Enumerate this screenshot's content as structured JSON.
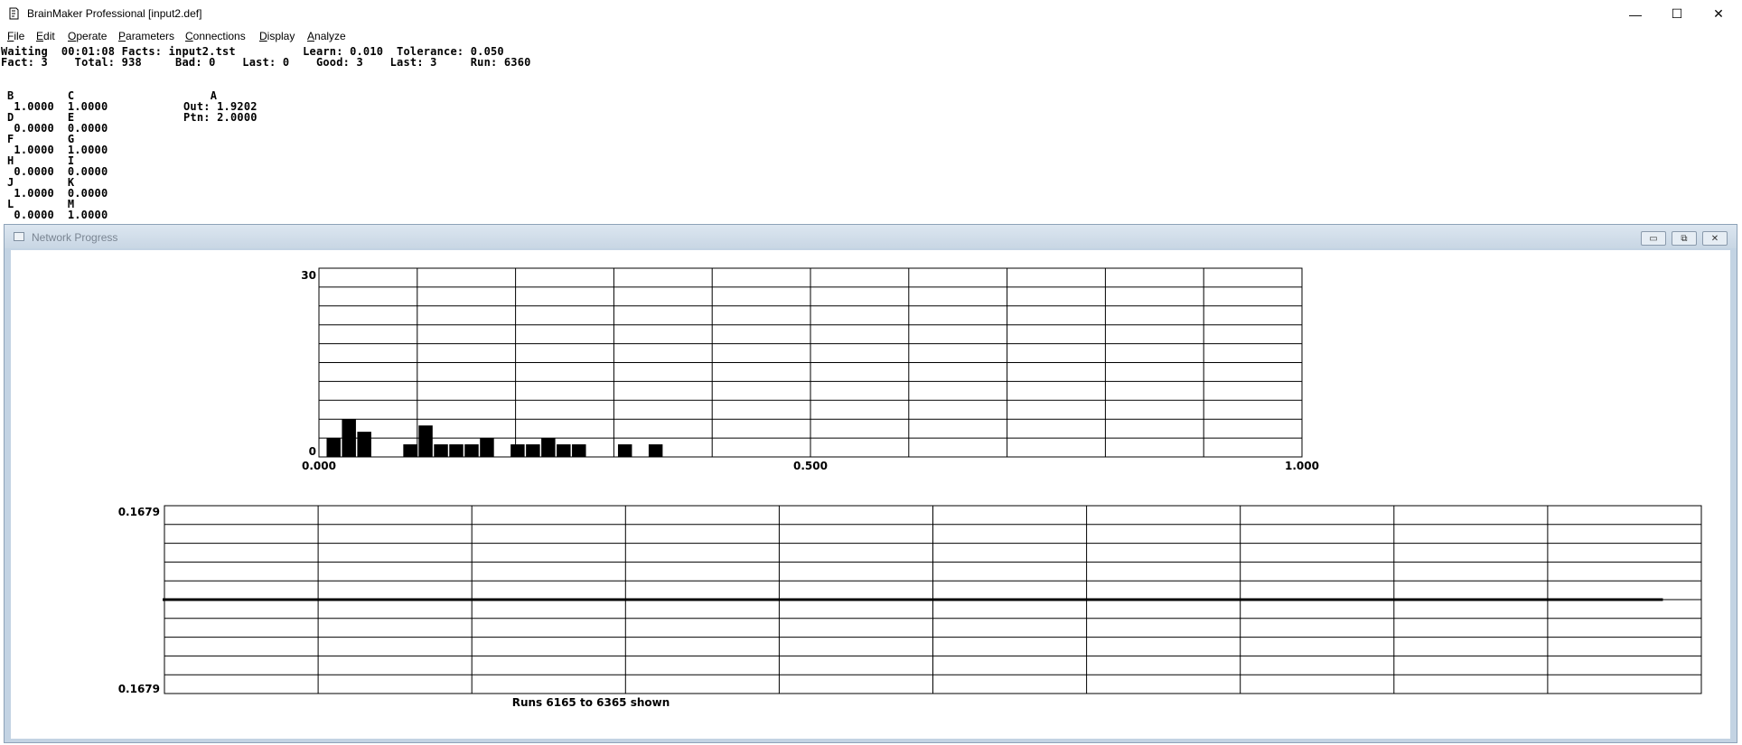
{
  "window": {
    "title": "BrainMaker Professional [input2.def]",
    "min_glyph": "—",
    "max_glyph": "☐",
    "close_glyph": "✕"
  },
  "menu": [
    {
      "accel": "F",
      "rest": "ile"
    },
    {
      "accel": "E",
      "rest": "dit"
    },
    {
      "accel": "O",
      "rest": "perate"
    },
    {
      "accel": "P",
      "rest": "arameters"
    },
    {
      "accel": "C",
      "rest": "onnections"
    },
    {
      "accel": "D",
      "rest": "isplay"
    },
    {
      "accel": "A",
      "rest": "nalyze"
    }
  ],
  "status": {
    "line1": "Waiting  00:01:08 Facts: input2.tst          Learn: 0.010  Tolerance: 0.050",
    "line2": "Fact: 3    Total: 938     Bad: 0    Last: 0    Good: 3    Last: 3     Run: 6360"
  },
  "neurons": {
    "left_block": "B        C\n 1.0000  1.0000\nD        E\n 0.0000  0.0000\nF        G\n 1.0000  1.0000\nH        I\n 0.0000  0.0000\nJ        K\n 1.0000  0.0000\nL        M\n 0.0000  1.0000",
    "output_block": "    A\nOut: 1.9202\nPtn: 2.0000"
  },
  "child_window": {
    "title": "Network Progress",
    "min_glyph": "▭",
    "max_glyph": "⧉",
    "close_glyph": "✕"
  },
  "chart_data": [
    {
      "type": "bar",
      "ylim": [
        0,
        30
      ],
      "xlim": [
        0.0,
        1.0
      ],
      "y_tick_labels": [
        "30",
        "0"
      ],
      "x_tick_labels": [
        "0.000",
        "0.500",
        "1.000"
      ],
      "bin_width": 0.0156,
      "bin_starts": [
        0.0078,
        0.0234,
        0.039,
        0.0546,
        0.0858,
        0.1014,
        0.117,
        0.1326,
        0.1482,
        0.1638,
        0.195,
        0.2106,
        0.2262,
        0.2418,
        0.2574,
        0.3042,
        0.3354
      ],
      "values": [
        3,
        6,
        4,
        0,
        2,
        5,
        2,
        2,
        2,
        3,
        2,
        2,
        3,
        2,
        2,
        2,
        2
      ],
      "grid": true
    },
    {
      "type": "line",
      "ylim": [
        0.1679,
        0.1679
      ],
      "y_tick_labels": [
        "0.1679",
        "0.1679"
      ],
      "run_range": [
        6165,
        6365
      ],
      "runs_end": 6360,
      "values_constant": 0.1679,
      "caption": "Runs 6165 to 6365 shown",
      "grid": true
    }
  ]
}
